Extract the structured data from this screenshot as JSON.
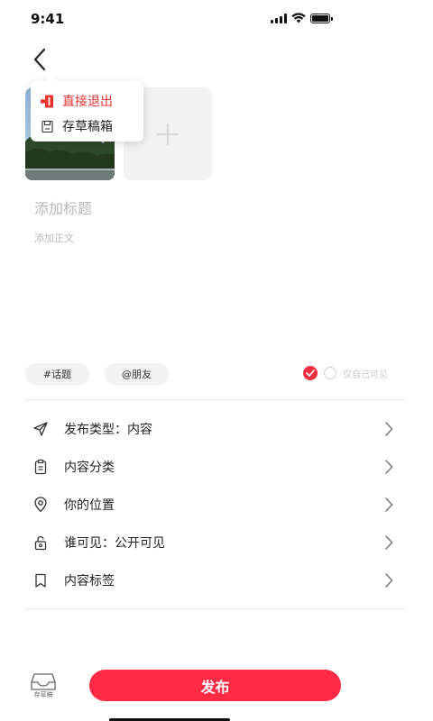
{
  "status_bar": {
    "time": "9:41"
  },
  "popup_menu": {
    "items": [
      {
        "label": "直接退出",
        "icon": "exit-door-icon",
        "color": "#e8322f"
      },
      {
        "label": "存草稿箱",
        "icon": "save-disk-icon"
      }
    ]
  },
  "editor": {
    "title_placeholder": "添加标题",
    "body_placeholder": "添加正文"
  },
  "chips": {
    "topic": "#话题",
    "friend": "@朋友"
  },
  "visibility": {
    "self_only_label": "仅自己可见"
  },
  "settings": [
    {
      "label": "发布类型：内容",
      "icon": "paper-plane-icon"
    },
    {
      "label": "内容分类",
      "icon": "clipboard-icon"
    },
    {
      "label": "你的位置",
      "icon": "location-pin-icon"
    },
    {
      "label": "谁可见：公开可见",
      "icon": "unlock-icon"
    },
    {
      "label": "内容标签",
      "icon": "bookmark-icon"
    }
  ],
  "bottom_bar": {
    "draft_label": "存草稿",
    "publish_label": "发布"
  },
  "colors": {
    "accent": "#ff2a44",
    "danger_text": "#e8322f"
  }
}
